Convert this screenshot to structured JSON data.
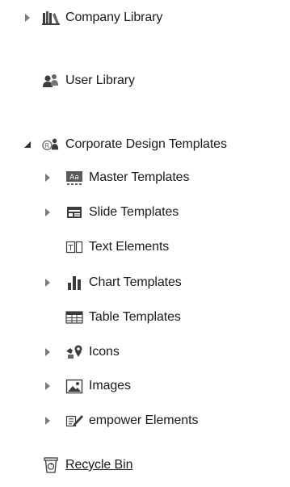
{
  "tree": {
    "company_library": {
      "label": "Company Library",
      "icon": "books-icon",
      "expanded": false
    },
    "user_library": {
      "label": "User Library",
      "icon": "users-icon"
    },
    "corporate_design": {
      "label": "Corporate Design Templates",
      "icon": "registered-folder-icon",
      "expanded": true,
      "children": [
        {
          "label": "Master Templates",
          "icon": "master-template-icon",
          "expandable": true
        },
        {
          "label": "Slide Templates",
          "icon": "slide-template-icon",
          "expandable": true
        },
        {
          "label": "Text Elements",
          "icon": "text-element-icon",
          "expandable": false
        },
        {
          "label": "Chart Templates",
          "icon": "bar-chart-icon",
          "expandable": true
        },
        {
          "label": "Table Templates",
          "icon": "table-icon",
          "expandable": false
        },
        {
          "label": "Icons",
          "icon": "icons-icon",
          "expandable": true
        },
        {
          "label": "Images",
          "icon": "image-icon",
          "expandable": true
        },
        {
          "label": "empower Elements",
          "icon": "empower-elements-icon",
          "expandable": true
        }
      ]
    },
    "recycle_bin": {
      "label": "Recycle Bin",
      "icon": "recycle-bin-icon"
    }
  },
  "colors": {
    "text": "#1a1a1a",
    "arrow": "#4a4a4a",
    "icon_dark": "#3c3c3c",
    "icon_mid": "#7a7a7a"
  }
}
